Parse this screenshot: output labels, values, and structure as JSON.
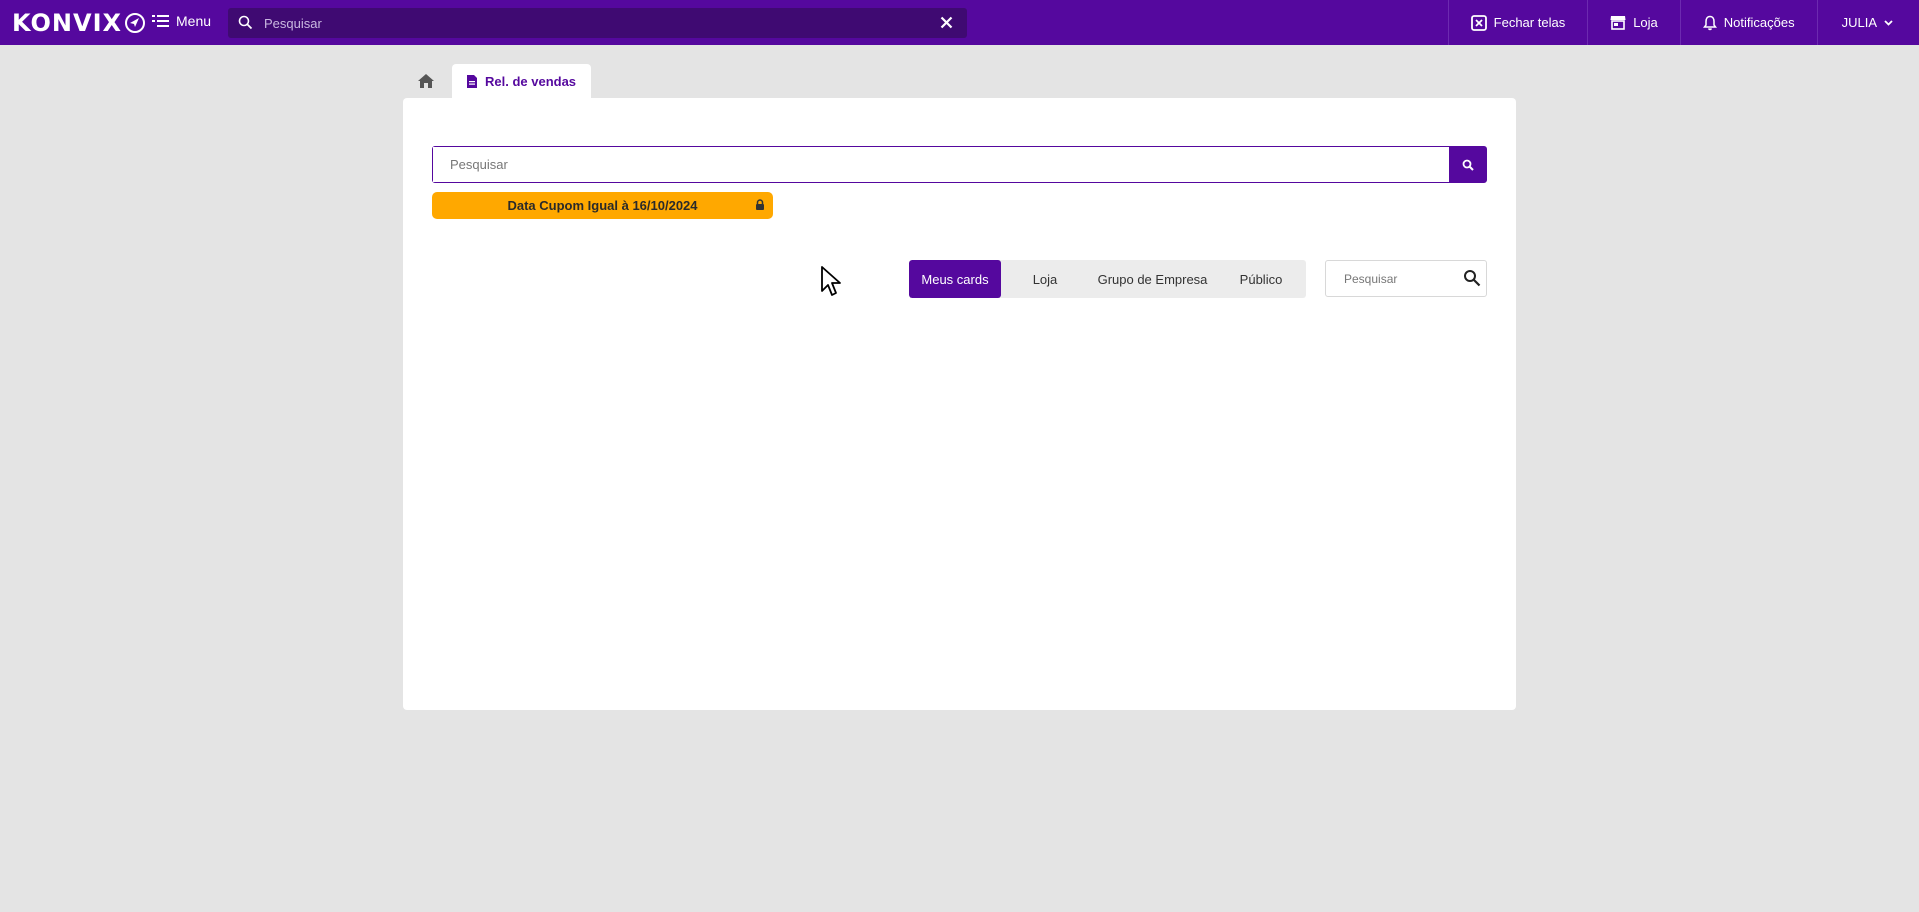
{
  "app": {
    "brand": "KONVIX",
    "menu_label": "Menu",
    "search_placeholder": "Pesquisar"
  },
  "header_actions": {
    "close_screens": "Fechar telas",
    "store": "Loja",
    "notifications": "Notificações",
    "user": "JULIA"
  },
  "tabs": {
    "active_label": "Rel. de vendas"
  },
  "main": {
    "search_placeholder": "Pesquisar",
    "filter_chip": "Data Cupom Igual à 16/10/2024",
    "segments": [
      "Meus cards",
      "Loja",
      "Grupo de Empresa",
      "Público"
    ],
    "active_segment": "Meus cards",
    "card_search_placeholder": "Pesquisar"
  },
  "colors": {
    "brand": "#55089e",
    "header_search_bg": "#3f0a72",
    "filter_chip": "#ffa800",
    "page_bg": "#e4e4e4"
  },
  "icons": {
    "menu": "menu-list-icon",
    "search": "search-icon",
    "clear": "close-icon",
    "close_screens": "close-window-icon",
    "store": "store-icon",
    "notifications": "bell-icon",
    "user_dropdown": "chevron-down-icon",
    "home": "home-icon",
    "report": "document-icon",
    "lock": "lock-icon"
  }
}
